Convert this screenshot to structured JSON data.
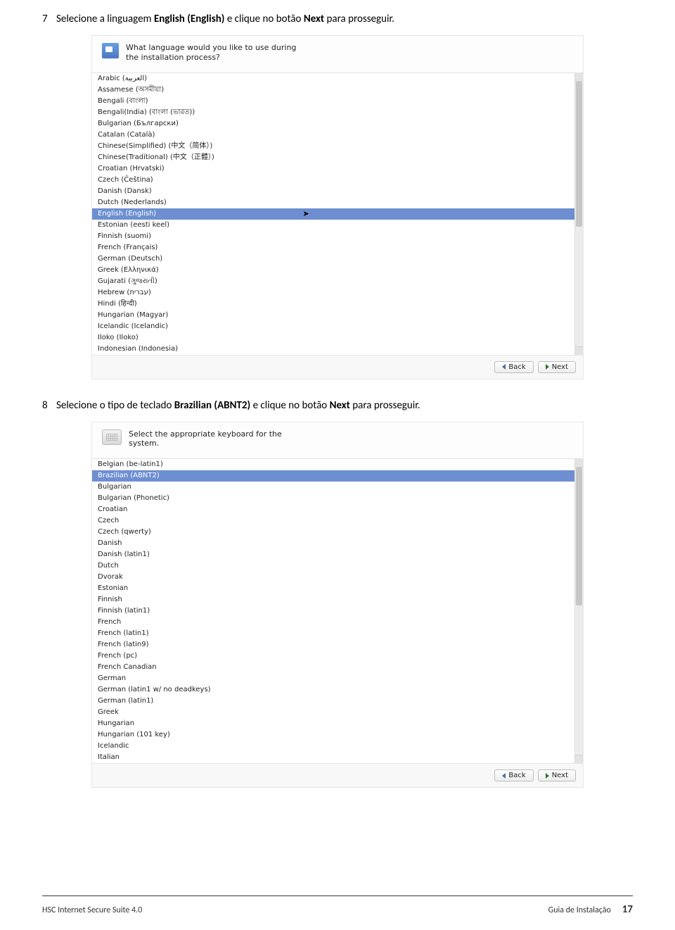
{
  "step7": {
    "number": "7",
    "text_a": "Selecione a linguagem ",
    "bold_a": "English (English)",
    "text_b": " e clique no botão ",
    "bold_b": "Next",
    "text_c": " para prosseguir."
  },
  "screenshot1": {
    "header_icon": "flag-icon",
    "header_text": "What language would you like to use during the installation process?",
    "selected_index": 12,
    "cursor_on_selected": true,
    "items": [
      "Arabic (العربية)",
      "Assamese (অসমীয়া)",
      "Bengali (বাংলা)",
      "Bengali(India) (বাংলা (ভারত))",
      "Bulgarian (Български)",
      "Catalan (Català)",
      "Chinese(Simplified) (中文（简体）)",
      "Chinese(Traditional) (中文（正體）)",
      "Croatian (Hrvatski)",
      "Czech (Čeština)",
      "Danish (Dansk)",
      "Dutch (Nederlands)",
      "English (English)",
      "Estonian (eesti keel)",
      "Finnish (suomi)",
      "French (Français)",
      "German (Deutsch)",
      "Greek (Ελληνικά)",
      "Gujarati (ગુજરાતી)",
      "Hebrew (עברית)",
      "Hindi (हिन्दी)",
      "Hungarian (Magyar)",
      "Icelandic (Icelandic)",
      "Iloko (Iloko)",
      "Indonesian (Indonesia)"
    ],
    "scroll_thumb": {
      "top_pct": 0,
      "height_pct": 55
    },
    "back_label": "Back",
    "next_label": "Next"
  },
  "step8": {
    "number": "8",
    "text_a": "Selecione o tipo de teclado ",
    "bold_a": "Brazilian (ABNT2)",
    "text_b": " e clique no botão ",
    "bold_b": "Next",
    "text_c": " para prosseguir."
  },
  "screenshot2": {
    "header_icon": "keyboard-icon",
    "header_text": "Select the appropriate keyboard for the system.",
    "selected_index": 1,
    "cursor_on_selected": false,
    "items": [
      "Belgian (be-latin1)",
      "Brazilian (ABNT2)",
      "Bulgarian",
      "Bulgarian (Phonetic)",
      "Croatian",
      "Czech",
      "Czech (qwerty)",
      "Danish",
      "Danish (latin1)",
      "Dutch",
      "Dvorak",
      "Estonian",
      "Finnish",
      "Finnish (latin1)",
      "French",
      "French (latin1)",
      "French (latin9)",
      "French (pc)",
      "French Canadian",
      "German",
      "German (latin1 w/ no deadkeys)",
      "German (latin1)",
      "Greek",
      "Hungarian",
      "Hungarian (101 key)",
      "Icelandic",
      "Italian"
    ],
    "scroll_thumb": {
      "top_pct": 0,
      "height_pct": 48
    },
    "back_label": "Back",
    "next_label": "Next"
  },
  "footer": {
    "left": "HSC Internet Secure Suite 4.0",
    "center": "Guia de Instalação",
    "page_number": "17"
  }
}
